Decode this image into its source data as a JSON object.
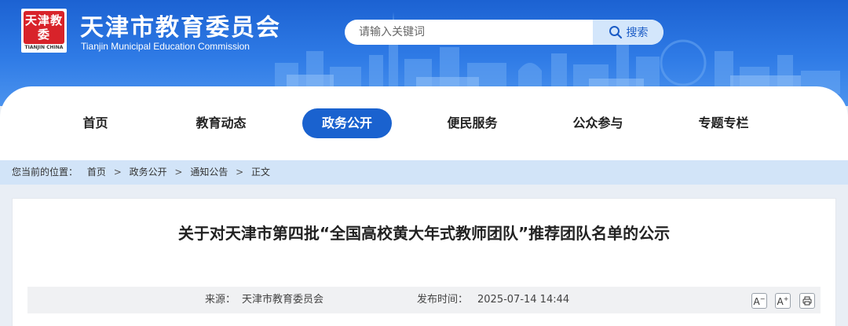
{
  "header": {
    "logo_text": "天津教委",
    "logo_caption": "TIANJIN CHINA",
    "title": "天津市教育委员会",
    "subtitle": "Tianjin Municipal Education Commission"
  },
  "search": {
    "placeholder": "请输入关键词",
    "button_label": "搜索",
    "icon": "search-icon"
  },
  "nav": {
    "items": [
      {
        "label": "首页",
        "active": false
      },
      {
        "label": "教育动态",
        "active": false
      },
      {
        "label": "政务公开",
        "active": true
      },
      {
        "label": "便民服务",
        "active": false
      },
      {
        "label": "公众参与",
        "active": false
      },
      {
        "label": "专题专栏",
        "active": false
      }
    ]
  },
  "breadcrumb": {
    "prefix": "您当前的位置：",
    "items": [
      "首页",
      "政务公开",
      "通知公告",
      "正文"
    ],
    "separator": ">"
  },
  "article": {
    "title": "关于对天津市第四批“全国高校黄大年式教师团队”推荐团队名单的公示",
    "source_label": "来源：",
    "source_value": "天津市教育委员会",
    "time_label": "发布时间：",
    "time_value": "2025-07-14 14:44"
  },
  "tools": {
    "decrease_font": "A",
    "increase_font": "A",
    "print_icon": "printer-icon"
  },
  "colors": {
    "brand_blue": "#1a62cf",
    "header_blue": "#2f7be6",
    "breadcrumb_bg": "#d2e4f8",
    "logo_red": "#d8232a"
  }
}
